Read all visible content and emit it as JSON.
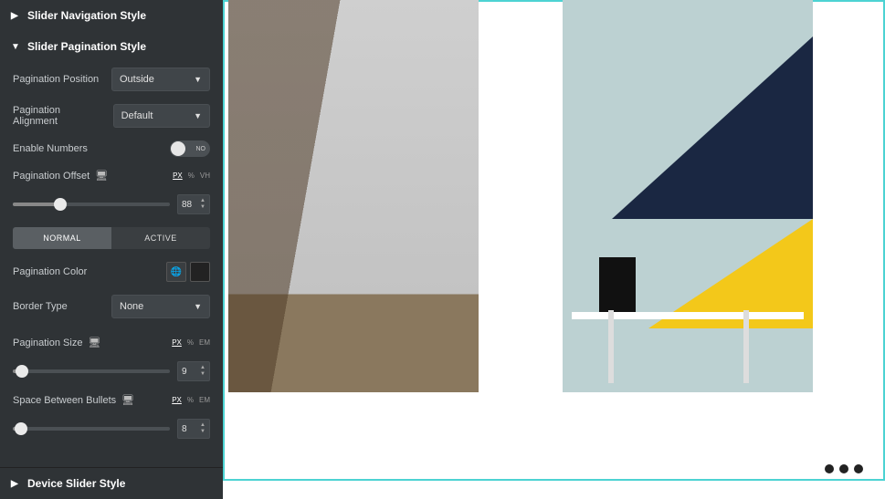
{
  "sections": {
    "nav_style": {
      "title": "Slider Navigation Style",
      "expanded": false
    },
    "pag_style": {
      "title": "Slider Pagination Style",
      "expanded": true
    },
    "device_style": {
      "title": "Device Slider Style",
      "expanded": false
    }
  },
  "controls": {
    "position": {
      "label": "Pagination Position",
      "value": "Outside"
    },
    "alignment": {
      "label": "Pagination Alignment",
      "value": "Default"
    },
    "enable_numbers": {
      "label": "Enable Numbers",
      "value": "NO"
    },
    "offset": {
      "label": "Pagination Offset",
      "value": "88",
      "units": [
        "PX",
        "%",
        "VH"
      ],
      "active_unit": "PX",
      "percent": 30
    },
    "tabs": {
      "normal": "NORMAL",
      "active": "ACTIVE",
      "selected": "normal"
    },
    "color": {
      "label": "Pagination Color"
    },
    "border": {
      "label": "Border Type",
      "value": "None"
    },
    "size": {
      "label": "Pagination Size",
      "value": "9",
      "units": [
        "PX",
        "%",
        "EM"
      ],
      "active_unit": "PX",
      "percent": 6
    },
    "spacing": {
      "label": "Space Between Bullets",
      "value": "8",
      "units": [
        "PX",
        "%",
        "EM"
      ],
      "active_unit": "PX",
      "percent": 5
    }
  },
  "canvas": {
    "pagination_dots": 3,
    "active_dot_index": 0
  }
}
